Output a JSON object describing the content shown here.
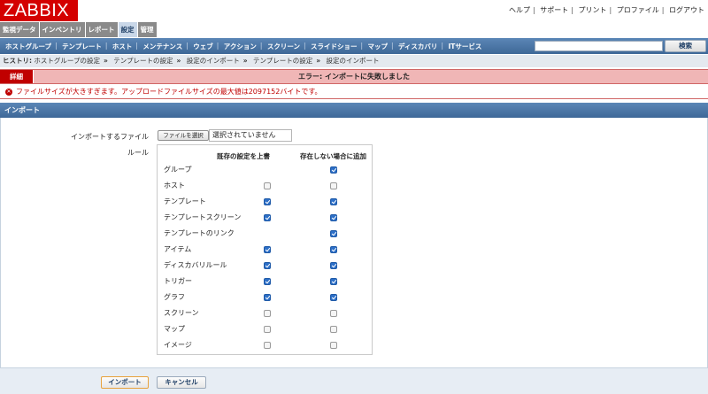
{
  "logo": "ZABBIX",
  "top_links": [
    "ヘルプ",
    "サポート",
    "プリント",
    "プロファイル",
    "ログアウト"
  ],
  "main_menu": [
    {
      "label": "監視データ"
    },
    {
      "label": "インベントリ"
    },
    {
      "label": "レポート"
    },
    {
      "label": "設定",
      "active": true
    },
    {
      "label": "管理"
    }
  ],
  "sub_menu": [
    "ホストグループ",
    "テンプレート",
    "ホスト",
    "メンテナンス",
    "ウェブ",
    "アクション",
    "スクリーン",
    "スライドショー",
    "マップ",
    "ディスカバリ",
    "ITサービス"
  ],
  "search": {
    "value": "",
    "button_label": "検索"
  },
  "history": {
    "label": "ヒストリ:",
    "crumbs": [
      "ホストグループの設定",
      "テンプレートの設定",
      "設定のインポート",
      "テンプレートの設定",
      "設定のインポート"
    ]
  },
  "error": {
    "details_label": "詳細",
    "title": "エラー: インポートに失敗しました",
    "message": "ファイルサイズが大きすぎます。アップロードファイルサイズの最大値は2097152バイトです。"
  },
  "form": {
    "title": "インポート",
    "file_label": "インポートするファイル",
    "file_button": "ファイルを選択",
    "file_status": "選択されていません",
    "rules_label": "ルール",
    "col_update": "既存の設定を上書",
    "col_create": "存在しない場合に追加",
    "rules": [
      {
        "name": "グループ",
        "update": null,
        "create": true
      },
      {
        "name": "ホスト",
        "update": false,
        "create": false
      },
      {
        "name": "テンプレート",
        "update": true,
        "create": true
      },
      {
        "name": "テンプレートスクリーン",
        "update": true,
        "create": true
      },
      {
        "name": "テンプレートのリンク",
        "update": null,
        "create": true
      },
      {
        "name": "アイテム",
        "update": true,
        "create": true
      },
      {
        "name": "ディスカバリルール",
        "update": true,
        "create": true
      },
      {
        "name": "トリガー",
        "update": true,
        "create": true
      },
      {
        "name": "グラフ",
        "update": true,
        "create": true
      },
      {
        "name": "スクリーン",
        "update": false,
        "create": false
      },
      {
        "name": "マップ",
        "update": false,
        "create": false
      },
      {
        "name": "イメージ",
        "update": false,
        "create": false
      }
    ]
  },
  "buttons": {
    "import": "インポート",
    "cancel": "キャンセル"
  },
  "colors": {
    "logo_red": "#d40000",
    "menu_blue": "#3e6897",
    "error_red": "#c00000",
    "error_bg": "#f0b6b6"
  }
}
